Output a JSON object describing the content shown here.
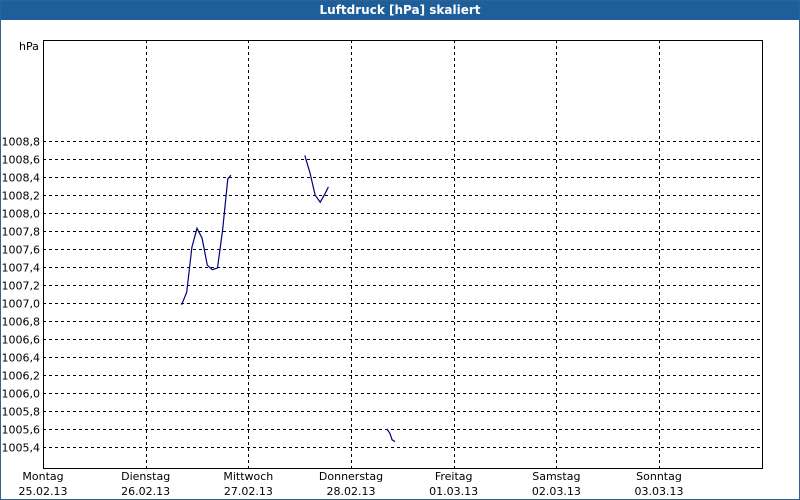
{
  "window": {
    "title": "Luftdruck [hPa] skaliert"
  },
  "chart_data": {
    "type": "line",
    "title": "Luftdruck [hPa] skaliert",
    "ylabel": "hPa",
    "ylim": [
      1005.3,
      1009.0
    ],
    "yticks": [
      1005.4,
      1005.6,
      1005.8,
      1006.0,
      1006.2,
      1006.4,
      1006.6,
      1006.8,
      1007.0,
      1007.2,
      1007.4,
      1007.6,
      1007.8,
      1008.0,
      1008.2,
      1008.4,
      1008.6,
      1008.8
    ],
    "ytick_labels": [
      "1005,4",
      "1005,6",
      "1005,8",
      "1006,0",
      "1006,2",
      "1006,4",
      "1006,6",
      "1006,8",
      "1007,0",
      "1007,2",
      "1007,4",
      "1007,6",
      "1007,8",
      "1008,0",
      "1008,2",
      "1008,4",
      "1008,6",
      "1008,8"
    ],
    "xlim": [
      0,
      7
    ],
    "xticks": [
      {
        "day": "Montag",
        "date": "25.02.13"
      },
      {
        "day": "Dienstag",
        "date": "26.02.13"
      },
      {
        "day": "Mittwoch",
        "date": "27.02.13"
      },
      {
        "day": "Donnerstag",
        "date": "28.02.13"
      },
      {
        "day": "Freitag",
        "date": "01.03.13"
      },
      {
        "day": "Samstag",
        "date": "02.03.13"
      },
      {
        "day": "Sonntag",
        "date": "03.03.13"
      }
    ],
    "grid": true,
    "line_color": "#00007f",
    "series": [
      {
        "segments": [
          [
            [
              1.35,
              1006.98
            ],
            [
              1.4,
              1007.12
            ],
            [
              1.45,
              1007.62
            ],
            [
              1.5,
              1007.83
            ],
            [
              1.55,
              1007.72
            ],
            [
              1.6,
              1007.42
            ],
            [
              1.65,
              1007.37
            ],
            [
              1.7,
              1007.39
            ],
            [
              1.75,
              1007.82
            ],
            [
              1.8,
              1008.38
            ],
            [
              1.83,
              1008.42
            ]
          ],
          [
            [
              2.55,
              1008.64
            ],
            [
              2.6,
              1008.45
            ],
            [
              2.65,
              1008.2
            ],
            [
              2.7,
              1008.12
            ],
            [
              2.75,
              1008.22
            ],
            [
              2.78,
              1008.29
            ]
          ],
          [
            [
              3.35,
              1005.6
            ],
            [
              3.38,
              1005.55
            ],
            [
              3.4,
              1005.48
            ],
            [
              3.43,
              1005.46
            ]
          ]
        ]
      }
    ]
  }
}
